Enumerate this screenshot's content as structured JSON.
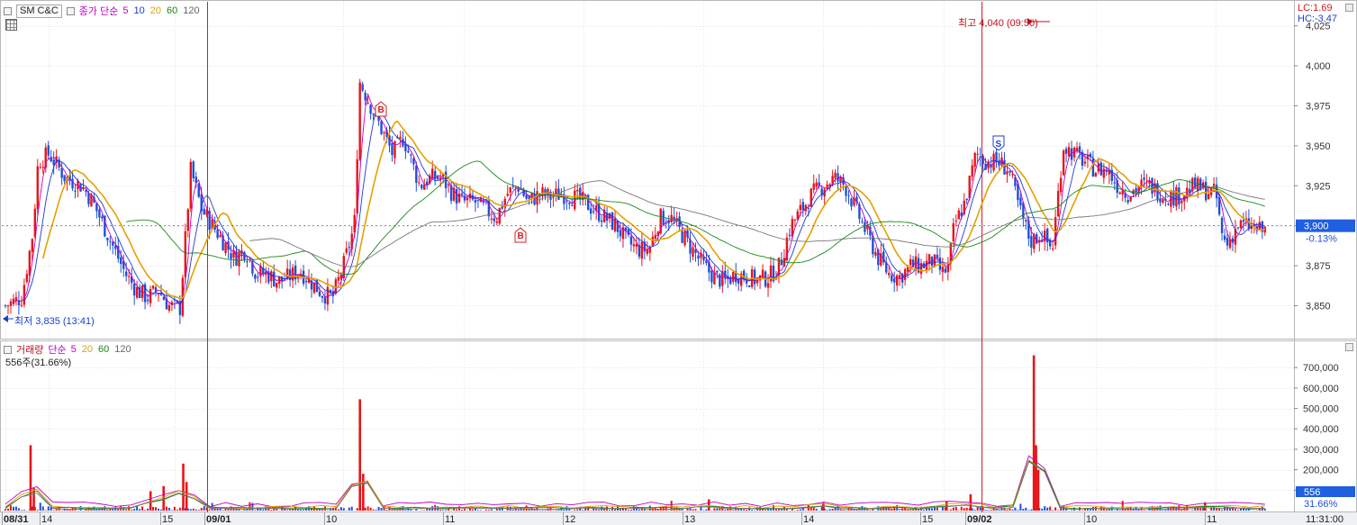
{
  "header": {
    "symbol": "SM C&C",
    "price_legend": {
      "label": "종가 단순",
      "periods": [
        {
          "text": "5",
          "color": "#c000c0"
        },
        {
          "text": "10",
          "color": "#1f3bd1"
        },
        {
          "text": "20",
          "color": "#e6a000"
        },
        {
          "text": "60",
          "color": "#1a8a1a"
        },
        {
          "text": "120",
          "color": "#666666"
        }
      ]
    },
    "lc": "LC:1.69",
    "hc": "HC:-3.47"
  },
  "annotations": {
    "high": "최고 4,040 (09:50)",
    "low": "최저 3,835 (13:41)",
    "buy_marker": "B",
    "sell_marker": "S"
  },
  "current_price": {
    "value": "3,900",
    "change": "-0.13%"
  },
  "volume_legend": {
    "label": "거래량",
    "ma_label": "단순",
    "periods": [
      {
        "text": "5",
        "color": "#c000c0"
      },
      {
        "text": "20",
        "color": "#e6a000"
      },
      {
        "text": "60",
        "color": "#1a8a1a"
      },
      {
        "text": "120",
        "color": "#666666"
      }
    ],
    "info": "556주(31.66%)",
    "current_value": "556",
    "current_pct": "31.66%"
  },
  "axes": {
    "x_labels": [
      "08/31",
      "14",
      "15",
      "09/01",
      "10",
      "11",
      "12",
      "13",
      "14",
      "15",
      "09/02",
      "10",
      "11",
      "11:31:00"
    ],
    "bold_labels": [
      "08/31",
      "09/01",
      "09/02"
    ],
    "price_ticks": [
      "4,025",
      "4,000",
      "3,975",
      "3,950",
      "3,925",
      "3,900",
      "3,875",
      "3,850"
    ],
    "volume_ticks": [
      "700,000",
      "600,000",
      "500,000",
      "400,000",
      "300,000",
      "200,000",
      "100,000"
    ]
  },
  "chart_data": [
    {
      "type": "candlestick",
      "title": "SM C&C",
      "ylim": [
        3830,
        4040
      ],
      "y_ticks": [
        3850,
        3875,
        3900,
        3925,
        3950,
        3975,
        4000,
        4025
      ],
      "x": [
        "08/31",
        "14",
        "15",
        "09/01",
        "10",
        "11",
        "12",
        "13",
        "14",
        "15",
        "09/02",
        "10",
        "11"
      ],
      "close_path": [
        [
          0,
          3850
        ],
        [
          1.5,
          3855
        ],
        [
          2.5,
          3895
        ],
        [
          3.0,
          3940
        ],
        [
          4.0,
          3945
        ],
        [
          5.5,
          3930
        ],
        [
          7.0,
          3925
        ],
        [
          8.0,
          3915
        ],
        [
          9.0,
          3900
        ],
        [
          10.0,
          3885
        ],
        [
          11.0,
          3870
        ],
        [
          12.0,
          3860
        ],
        [
          13.0,
          3855
        ],
        [
          14.0,
          3860
        ],
        [
          15.0,
          3850
        ],
        [
          16.0,
          3848
        ],
        [
          17.0,
          3935
        ],
        [
          18.0,
          3910
        ],
        [
          19.0,
          3900
        ],
        [
          20.0,
          3890
        ],
        [
          21.0,
          3880
        ],
        [
          22.0,
          3885
        ],
        [
          23.0,
          3870
        ],
        [
          24.0,
          3870
        ],
        [
          25.0,
          3865
        ],
        [
          26.0,
          3868
        ],
        [
          27.0,
          3872
        ],
        [
          28.0,
          3865
        ],
        [
          29.0,
          3858
        ],
        [
          30.0,
          3855
        ],
        [
          31.0,
          3875
        ],
        [
          32.0,
          3900
        ],
        [
          32.5,
          3990
        ],
        [
          33.5,
          3975
        ],
        [
          34.5,
          3960
        ],
        [
          35.5,
          3945
        ],
        [
          36.5,
          3955
        ],
        [
          37.0,
          3945
        ],
        [
          38.0,
          3925
        ],
        [
          39.0,
          3930
        ],
        [
          40.0,
          3930
        ],
        [
          41.0,
          3920
        ],
        [
          42.0,
          3915
        ],
        [
          43.0,
          3915
        ],
        [
          44.0,
          3910
        ],
        [
          45.0,
          3905
        ],
        [
          46.0,
          3920
        ],
        [
          47.0,
          3925
        ],
        [
          48.0,
          3915
        ],
        [
          49.0,
          3920
        ],
        [
          50.0,
          3918
        ],
        [
          51.0,
          3920
        ],
        [
          52.0,
          3918
        ],
        [
          53.0,
          3915
        ],
        [
          54.0,
          3910
        ],
        [
          55.0,
          3905
        ],
        [
          56.0,
          3900
        ],
        [
          57.0,
          3890
        ],
        [
          58.0,
          3885
        ],
        [
          59.0,
          3885
        ],
        [
          60.0,
          3905
        ],
        [
          61.0,
          3905
        ],
        [
          62.0,
          3895
        ],
        [
          63.0,
          3885
        ],
        [
          64.0,
          3875
        ],
        [
          65.0,
          3868
        ],
        [
          66.0,
          3865
        ],
        [
          67.0,
          3870
        ],
        [
          68.0,
          3868
        ],
        [
          69.0,
          3866
        ],
        [
          70.0,
          3868
        ],
        [
          71.0,
          3875
        ],
        [
          72.0,
          3900
        ],
        [
          73.0,
          3910
        ],
        [
          74.0,
          3920
        ],
        [
          75.0,
          3925
        ],
        [
          76.0,
          3930
        ],
        [
          77.0,
          3925
        ],
        [
          78.0,
          3910
        ],
        [
          79.0,
          3895
        ],
        [
          80.0,
          3880
        ],
        [
          81.0,
          3870
        ],
        [
          82.0,
          3868
        ],
        [
          83.0,
          3875
        ],
        [
          84.0,
          3875
        ],
        [
          85.0,
          3878
        ],
        [
          86.0,
          3870
        ],
        [
          86.5,
          3875
        ],
        [
          87.0,
          3900
        ],
        [
          88.0,
          3915
        ],
        [
          89.0,
          3945
        ],
        [
          90.0,
          3940
        ],
        [
          91.0,
          3940
        ],
        [
          92.0,
          3935
        ],
        [
          93.0,
          3910
        ],
        [
          94.0,
          3890
        ],
        [
          95.0,
          3895
        ],
        [
          96.0,
          3885
        ],
        [
          97.0,
          3950
        ],
        [
          98.0,
          3945
        ],
        [
          99.0,
          3940
        ],
        [
          100.0,
          3935
        ],
        [
          101.0,
          3935
        ],
        [
          102.0,
          3925
        ],
        [
          103.0,
          3920
        ],
        [
          104.0,
          3925
        ],
        [
          105.0,
          3925
        ],
        [
          106.0,
          3920
        ],
        [
          107.0,
          3918
        ],
        [
          108.0,
          3920
        ],
        [
          109.0,
          3925
        ],
        [
          110.0,
          3922
        ],
        [
          111.0,
          3920
        ],
        [
          111.5,
          3895
        ],
        [
          112.0,
          3888
        ],
        [
          113.0,
          3900
        ],
        [
          114.0,
          3900
        ],
        [
          115.0,
          3897
        ]
      ],
      "x_range": [
        0,
        117.5
      ],
      "volume_ticks": [
        100000,
        200000,
        300000,
        400000,
        500000,
        600000,
        700000
      ],
      "volume_ylim": [
        0,
        780000
      ],
      "volume_spikes": [
        [
          2.3,
          320000
        ],
        [
          2.6,
          110000
        ],
        [
          13.3,
          95000
        ],
        [
          14.5,
          120000
        ],
        [
          16.3,
          230000
        ],
        [
          16.6,
          140000
        ],
        [
          32.5,
          545000
        ],
        [
          32.8,
          180000
        ],
        [
          64.5,
          55000
        ],
        [
          75.0,
          42000
        ],
        [
          86.3,
          45000
        ],
        [
          88.5,
          80000
        ],
        [
          94.3,
          760000
        ],
        [
          94.5,
          320000
        ],
        [
          94.7,
          200000
        ],
        [
          110.0,
          40000
        ]
      ]
    }
  ]
}
